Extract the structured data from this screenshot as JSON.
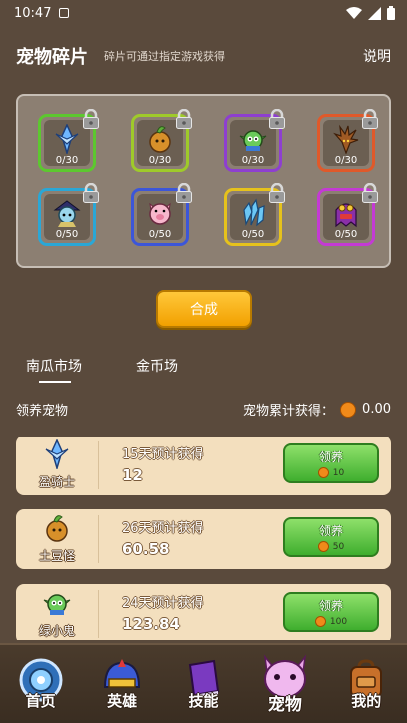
{
  "status_bar": {
    "time": "10:47"
  },
  "header": {
    "title": "宠物碎片",
    "subtitle": "碎片可通过指定游戏获得",
    "help_label": "说明"
  },
  "fragments": [
    {
      "name": "ice-knight",
      "count": "0/30",
      "border": "#5cc82f",
      "locked": true
    },
    {
      "name": "potato-monster",
      "count": "0/30",
      "border": "#9fca2a",
      "locked": true
    },
    {
      "name": "green-imp",
      "count": "0/30",
      "border": "#8e3fd0",
      "locked": true
    },
    {
      "name": "tree-spirit",
      "count": "0/30",
      "border": "#e0592a",
      "locked": true
    },
    {
      "name": "cyan-witch",
      "count": "0/50",
      "border": "#2aa7d6",
      "locked": true
    },
    {
      "name": "pink-pig",
      "count": "0/50",
      "border": "#3c56d9",
      "locked": true
    },
    {
      "name": "blue-crystal",
      "count": "0/50",
      "border": "#e6c21c",
      "locked": true
    },
    {
      "name": "purple-ghost",
      "count": "0/50",
      "border": "#c43ad4",
      "locked": true
    }
  ],
  "synth_button": {
    "label": "合成"
  },
  "tabs": [
    {
      "label": "南瓜市场",
      "active": true
    },
    {
      "label": "金币场",
      "active": false
    }
  ],
  "section": {
    "title": "领养宠物",
    "earned_label": "宠物累计获得：",
    "earned_value": "0.00"
  },
  "pets": [
    {
      "name": "盈骑士",
      "days_label": "15天预计获得",
      "value": "12",
      "adopt_label": "领养",
      "price": "10"
    },
    {
      "name": "土豆怪",
      "days_label": "26天预计获得",
      "value": "60.58",
      "adopt_label": "领养",
      "price": "50"
    },
    {
      "name": "绿小鬼",
      "days_label": "24天预计获得",
      "value": "123.84",
      "adopt_label": "领养",
      "price": "100"
    }
  ],
  "bottom_nav": [
    {
      "label": "首页",
      "icon": "home-portal-icon",
      "active": false
    },
    {
      "label": "英雄",
      "icon": "hero-helmet-icon",
      "active": false
    },
    {
      "label": "技能",
      "icon": "skill-book-icon",
      "active": false
    },
    {
      "label": "宠物",
      "icon": "pet-monster-icon",
      "active": true
    },
    {
      "label": "我的",
      "icon": "backpack-icon",
      "active": false
    }
  ],
  "colors": {
    "background": "#5a4a3c",
    "panel": "#8c7f72",
    "card": "#f3dfbe",
    "gold_button": "#f2a000",
    "green_button": "#3fae2e"
  }
}
